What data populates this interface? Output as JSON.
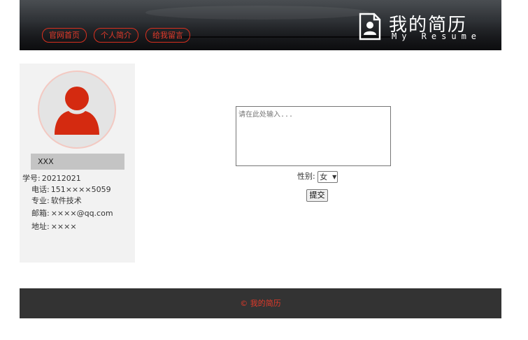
{
  "header": {
    "nav": [
      "官网首页",
      "个人简介",
      "给我留言"
    ],
    "brand_title": "我的简历",
    "brand_subtitle": "My Resume",
    "accent_color": "#e23a2a"
  },
  "profile": {
    "name": "XXX",
    "avatar_color": "#d42a10",
    "fields": [
      {
        "label": "学号:",
        "value": "20212021"
      },
      {
        "label": "电话:",
        "value": "151××××5059"
      },
      {
        "label": "专业:",
        "value": "软件技术"
      },
      {
        "label": "邮箱:",
        "value": "××××@qq.com"
      },
      {
        "label": "地址:",
        "value": "××××"
      }
    ]
  },
  "form": {
    "message_placeholder": "请在此处输入...",
    "gender_label": "性别:",
    "gender_selected": "女",
    "submit_label": "提交"
  },
  "footer": {
    "text": "© 我的简历"
  }
}
